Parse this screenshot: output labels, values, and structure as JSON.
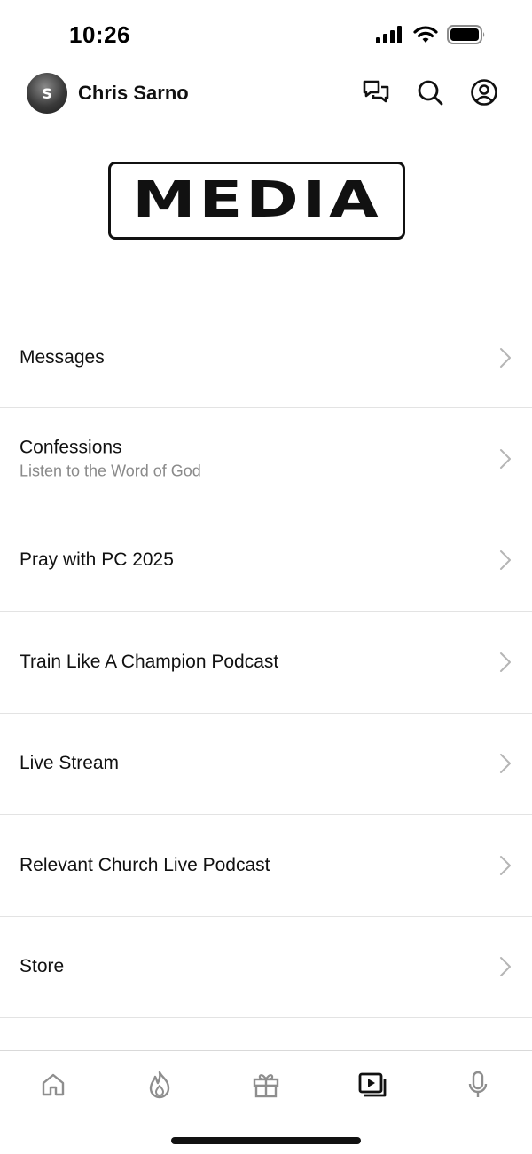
{
  "status_bar": {
    "time": "10:26",
    "icons": [
      "cellular-signal-icon",
      "wifi-icon",
      "battery-icon"
    ]
  },
  "header": {
    "user_name": "Chris Sarno",
    "avatar_initial": "S",
    "actions": [
      {
        "name": "chat-icon"
      },
      {
        "name": "search-icon"
      },
      {
        "name": "profile-icon"
      }
    ]
  },
  "logo": {
    "text": "MEDIA"
  },
  "menu": {
    "items": [
      {
        "label": "Messages",
        "subtitle": ""
      },
      {
        "label": "Confessions",
        "subtitle": "Listen to the Word of God"
      },
      {
        "label": "Pray with PC 2025",
        "subtitle": ""
      },
      {
        "label": "Train Like A Champion Podcast",
        "subtitle": ""
      },
      {
        "label": "Live Stream",
        "subtitle": ""
      },
      {
        "label": "Relevant Church Live Podcast",
        "subtitle": ""
      },
      {
        "label": "Store",
        "subtitle": ""
      }
    ]
  },
  "tab_bar": {
    "tabs": [
      {
        "icon": "home-icon",
        "active": false
      },
      {
        "icon": "flame-icon",
        "active": false
      },
      {
        "icon": "gift-icon",
        "active": false
      },
      {
        "icon": "media-icon",
        "active": true
      },
      {
        "icon": "microphone-icon",
        "active": false
      }
    ]
  },
  "colors": {
    "text_primary": "#111111",
    "text_secondary": "#8a8a8a",
    "divider": "#e3e3e3",
    "icon_inactive": "#8e8e8e",
    "icon_active": "#111111",
    "background": "#ffffff"
  }
}
